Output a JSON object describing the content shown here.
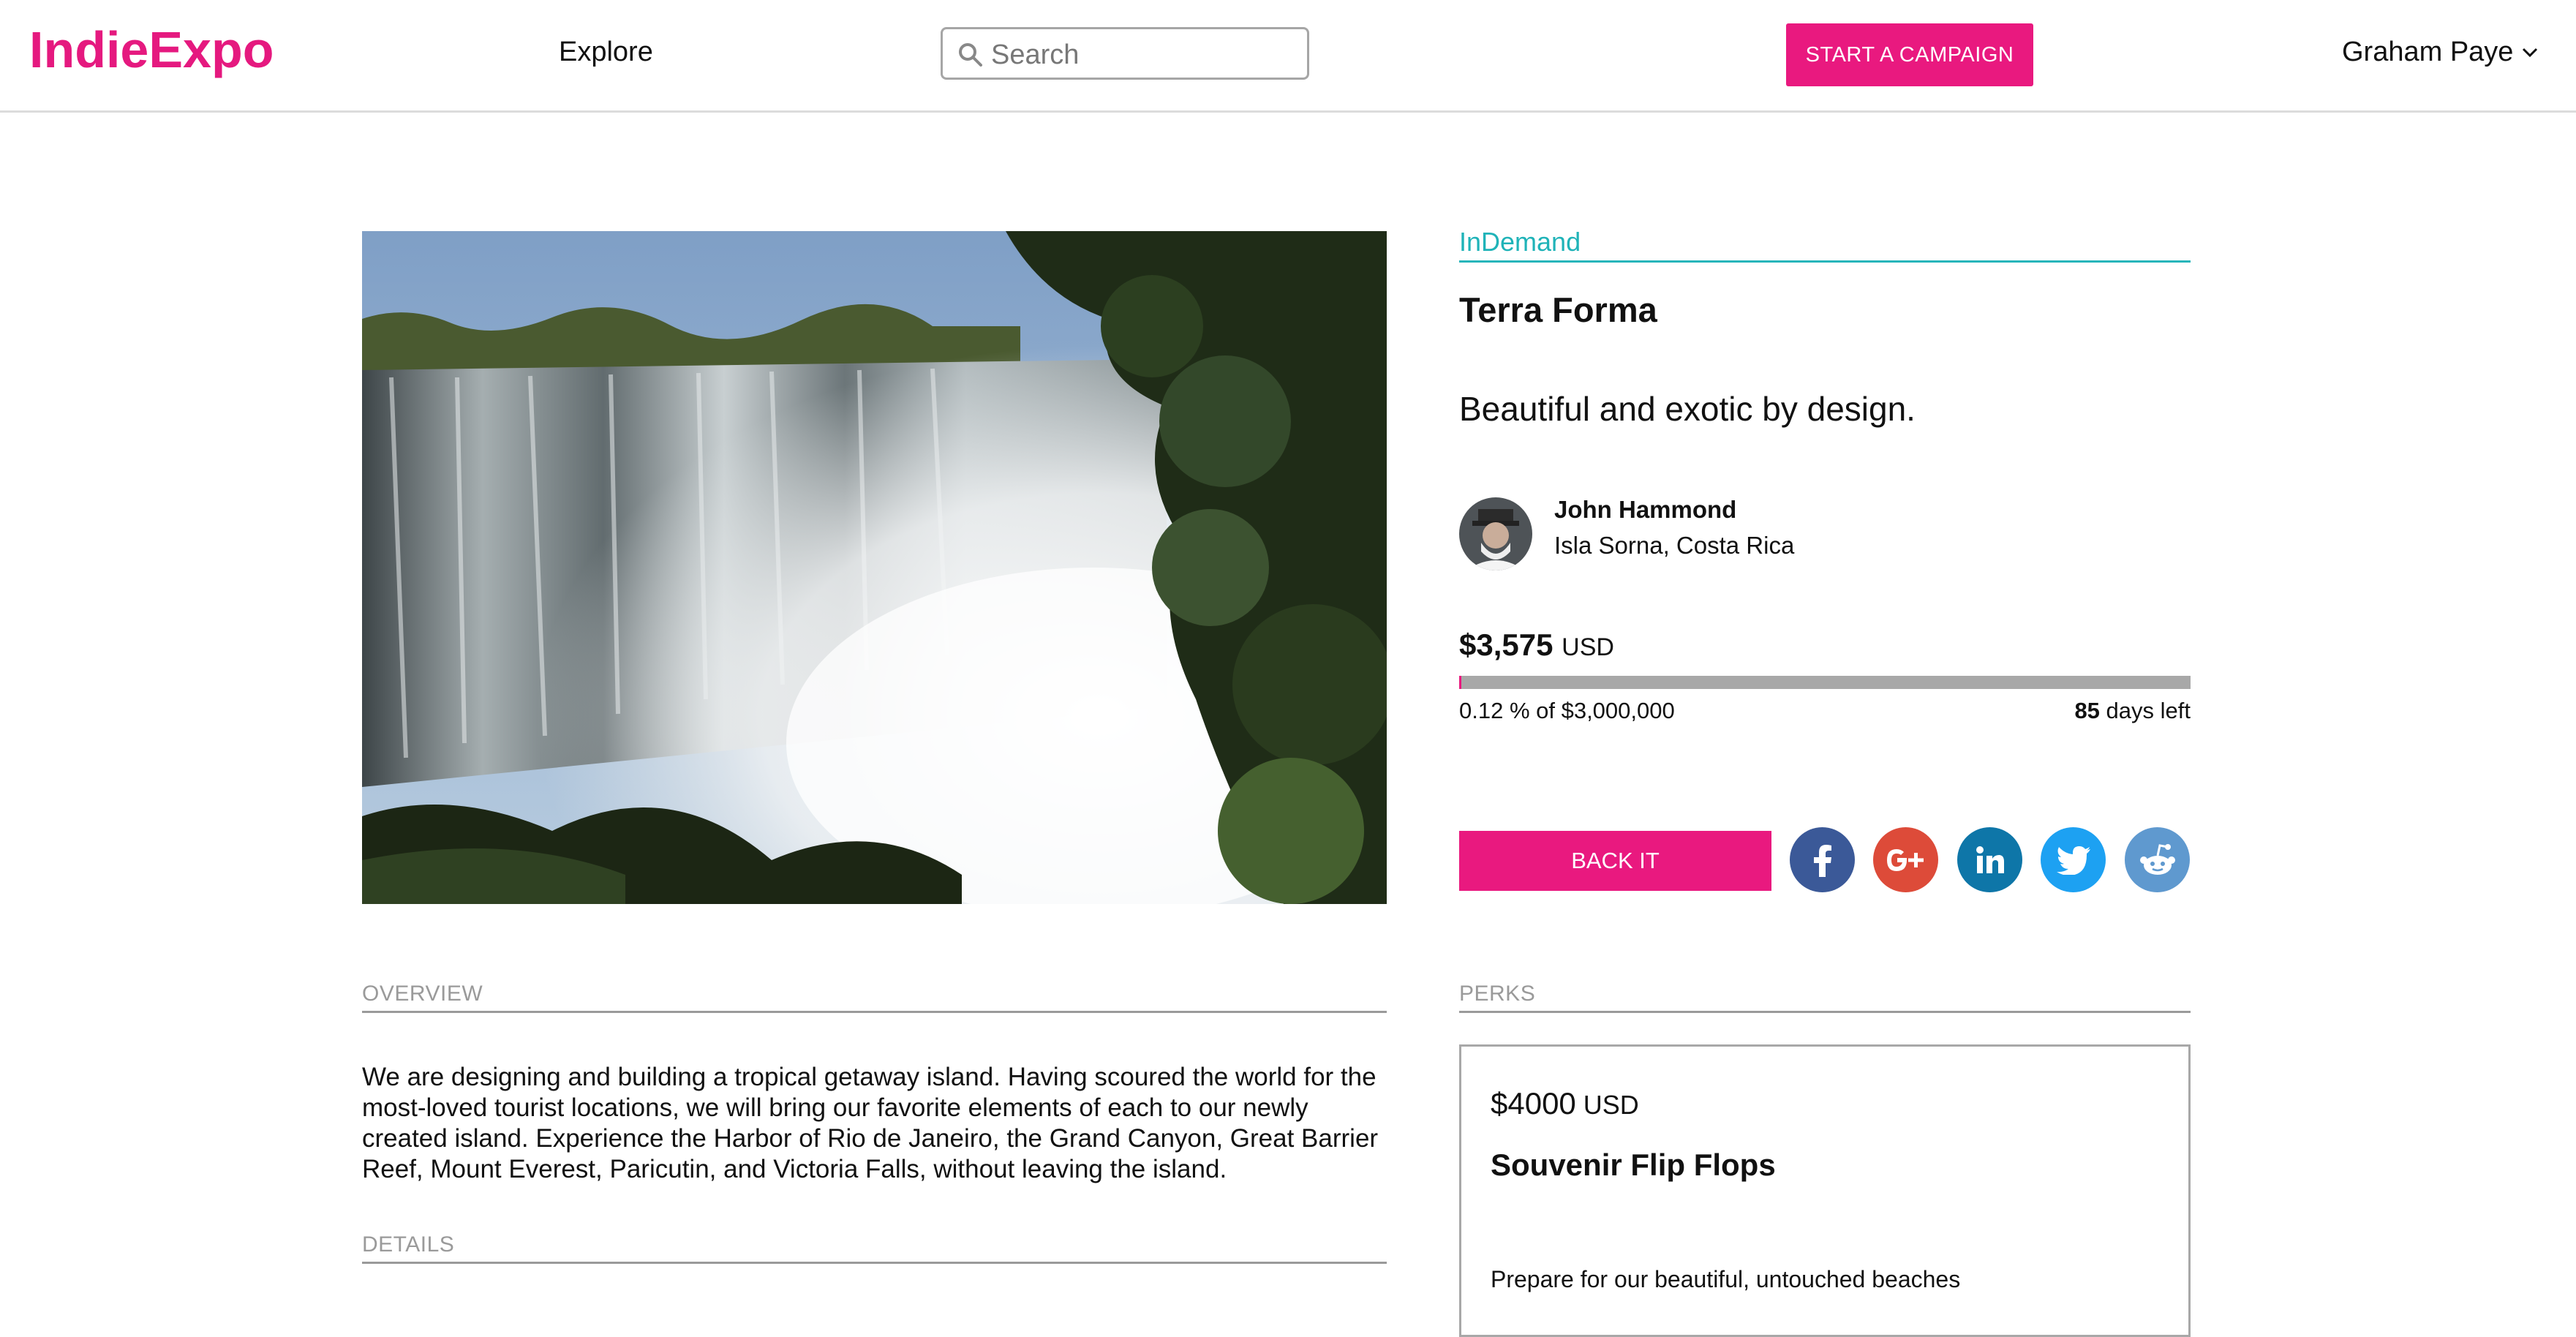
{
  "header": {
    "logo": "IndieExpo",
    "nav_explore": "Explore",
    "search_placeholder": "Search",
    "start_campaign": "START A CAMPAIGN",
    "user_name": "Graham Paye"
  },
  "campaign": {
    "category": "InDemand",
    "title": "Terra Forma",
    "tagline": "Beautiful and exotic by design.",
    "creator_name": "John Hammond",
    "creator_location": "Isla Sorna, Costa Rica",
    "raised_amount": "$3,575",
    "raised_currency": "USD",
    "progress_text": "0.12 % of $3,000,000",
    "progress_percent": 0.12,
    "days_left_number": "85",
    "days_left_label": "days left",
    "back_it": "BACK IT"
  },
  "social": [
    "facebook-icon",
    "google-plus-icon",
    "linkedin-icon",
    "twitter-icon",
    "reddit-icon"
  ],
  "overview": {
    "heading": "OVERVIEW",
    "text": "We are designing and building a tropical getaway island. Having scoured the world for the most-loved tourist locations, we will bring our favorite elements of each to our newly created island. Experience the Harbor of Rio de Janeiro, the Grand Canyon, Great Barrier Reef, Mount Everest, Paricutin, and Victoria Falls, without leaving the island."
  },
  "details": {
    "heading": "DETAILS"
  },
  "perks": {
    "heading": "PERKS",
    "items": [
      {
        "price": "$4000",
        "currency": "USD",
        "name": "Souvenir Flip Flops",
        "description": "Prepare for our beautiful, untouched beaches"
      }
    ]
  },
  "colors": {
    "brand": "#e9197f",
    "accent": "#1fb3b8",
    "progress_track": "#a8a8a8"
  }
}
